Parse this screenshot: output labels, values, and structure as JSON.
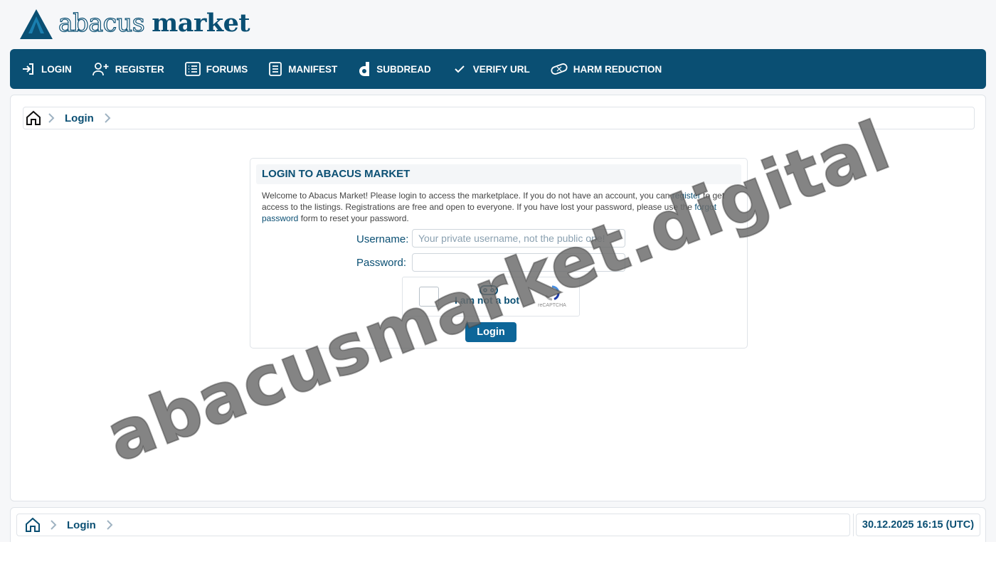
{
  "logo": {
    "word1": "abacus",
    "word2": "market"
  },
  "nav": [
    {
      "label": "LOGIN",
      "icon": "login-icon"
    },
    {
      "label": "REGISTER",
      "icon": "add-user-icon"
    },
    {
      "label": "FORUMS",
      "icon": "list-icon"
    },
    {
      "label": "MANIFEST",
      "icon": "document-icon"
    },
    {
      "label": "SUBDREAD",
      "icon": "dread-icon"
    },
    {
      "label": "VERIFY URL",
      "icon": "check-icon"
    },
    {
      "label": "HARM REDUCTION",
      "icon": "bandage-icon"
    }
  ],
  "breadcrumb": {
    "current": "Login"
  },
  "login": {
    "title": "LOGIN TO ABACUS MARKET",
    "welcome_1": "Welcome to Abacus Market! Please login to access the marketplace. If you do not have an account, you can ",
    "register_link": "register",
    "welcome_2": " to get access to the listings. Registrations are free and open to everyone. If you have lost your password, please use the ",
    "forgot_link": "forgot password",
    "welcome_3": " form to reset your password.",
    "username_label": "Username:",
    "username_placeholder": "Your private username, not the public one!",
    "password_label": "Password:",
    "captcha_text": "I am not a bot",
    "captcha_brand": "reCAPTCHA",
    "button": "Login"
  },
  "footer": {
    "crumb": "Login",
    "timestamp": "30.12.2025 16:15 (UTC)"
  },
  "watermark": "abacusmarket.digital",
  "colors": {
    "primary": "#0a4f73",
    "button": "#0d6699",
    "background": "#f6f7f9"
  }
}
